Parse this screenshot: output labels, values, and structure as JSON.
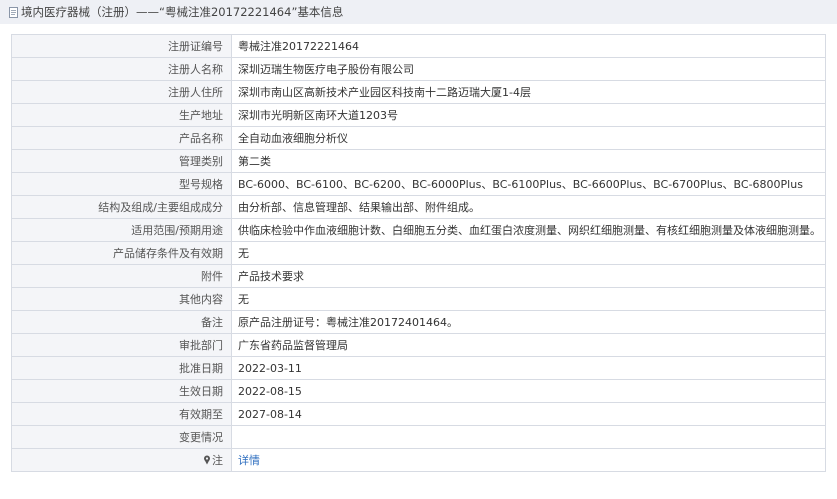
{
  "header": {
    "icon": "document-icon",
    "title": "境内医疗器械（注册）——“粤械注准20172221464”基本信息"
  },
  "rows": [
    {
      "label": "注册证编号",
      "value": "粤械注准20172221464"
    },
    {
      "label": "注册人名称",
      "value": "深圳迈瑞生物医疗电子股份有限公司"
    },
    {
      "label": "注册人住所",
      "value": "深圳市南山区高新技术产业园区科技南十二路迈瑞大厦1-4层"
    },
    {
      "label": "生产地址",
      "value": "深圳市光明新区南环大道1203号"
    },
    {
      "label": "产品名称",
      "value": "全自动血液细胞分析仪"
    },
    {
      "label": "管理类别",
      "value": "第二类"
    },
    {
      "label": "型号规格",
      "value": "BC-6000、BC-6100、BC-6200、BC-6000Plus、BC-6100Plus、BC-6600Plus、BC-6700Plus、BC-6800Plus"
    },
    {
      "label": "结构及组成/主要组成成分",
      "value": "由分析部、信息管理部、结果输出部、附件组成。"
    },
    {
      "label": "适用范围/预期用途",
      "value": "供临床检验中作血液细胞计数、白细胞五分类、血红蛋白浓度测量、网织红细胞测量、有核红细胞测量及体液细胞测量。"
    },
    {
      "label": "产品储存条件及有效期",
      "value": "无"
    },
    {
      "label": "附件",
      "value": "产品技术要求"
    },
    {
      "label": "其他内容",
      "value": "无"
    },
    {
      "label": "备注",
      "value": "原产品注册证号：粤械注准20172401464。"
    },
    {
      "label": "审批部门",
      "value": "广东省药品监督管理局"
    },
    {
      "label": "批准日期",
      "value": "2022-03-11"
    },
    {
      "label": "生效日期",
      "value": "2022-08-15"
    },
    {
      "label": "有效期至",
      "value": "2027-08-14"
    },
    {
      "label": "变更情况",
      "value": ""
    }
  ],
  "note_row": {
    "icon": "pin-icon",
    "label": "注",
    "link_text": "详情",
    "link_color": "#2c6dbf"
  }
}
